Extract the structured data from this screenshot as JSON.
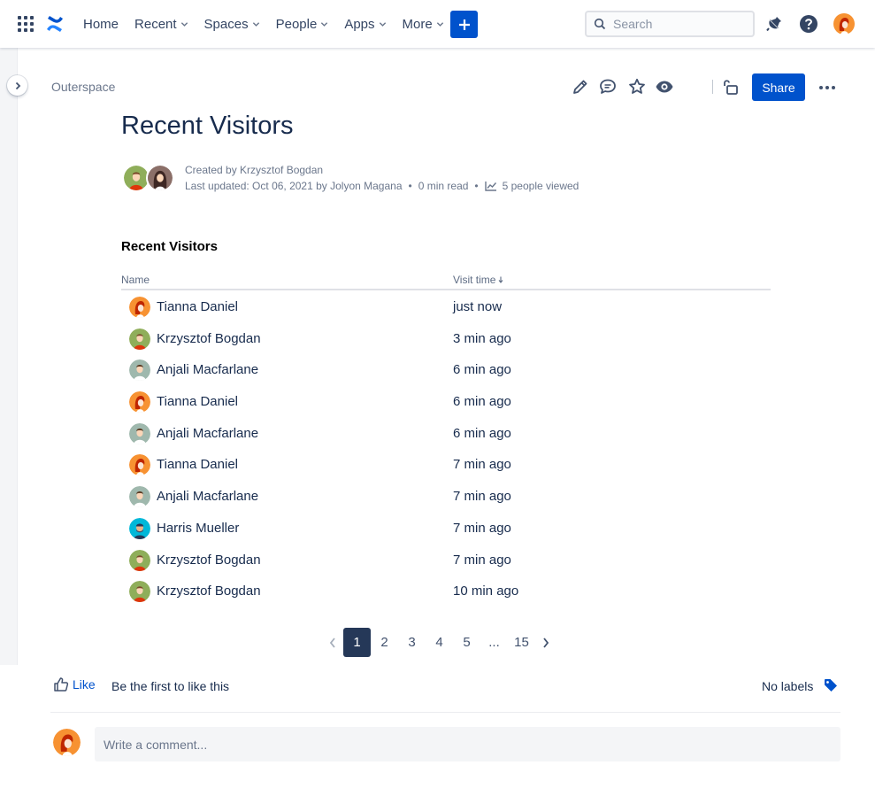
{
  "colors": {
    "brand": "#0052cc",
    "text": "#172b4d",
    "subtle": "#6b778c",
    "active_page": "#253858"
  },
  "topbar": {
    "nav": [
      {
        "label": "Home",
        "has_caret": false
      },
      {
        "label": "Recent",
        "has_caret": true
      },
      {
        "label": "Spaces",
        "has_caret": true
      },
      {
        "label": "People",
        "has_caret": true
      },
      {
        "label": "Apps",
        "has_caret": true
      },
      {
        "label": "More",
        "has_caret": true
      }
    ],
    "create_icon": "plus-icon",
    "search_placeholder": "Search",
    "icons": [
      "notification-icon",
      "help-icon",
      "user-avatar"
    ]
  },
  "breadcrumb": "Outerspace",
  "page_actions": {
    "icons": [
      "edit-icon",
      "comment-icon",
      "star-icon",
      "watch-icon",
      "restrictions-icon"
    ],
    "share_label": "Share"
  },
  "page": {
    "title": "Recent Visitors",
    "created_by": "Created by Krzysztof Bogdan",
    "last_updated": "Last updated: Oct 06, 2021 by Jolyon Magana",
    "read_time": "0 min read",
    "viewed": "5 people viewed"
  },
  "visitors": {
    "section_title": "Recent Visitors",
    "columns": {
      "name": "Name",
      "time": "Visit time"
    },
    "rows": [
      {
        "name": "Tianna Daniel",
        "time": "just now",
        "avatar": "tianna"
      },
      {
        "name": "Krzysztof Bogdan",
        "time": "3 min ago",
        "avatar": "krzysztof"
      },
      {
        "name": "Anjali Macfarlane",
        "time": "6 min ago",
        "avatar": "anjali"
      },
      {
        "name": "Tianna Daniel",
        "time": "6 min ago",
        "avatar": "tianna"
      },
      {
        "name": "Anjali Macfarlane",
        "time": "6 min ago",
        "avatar": "anjali"
      },
      {
        "name": "Tianna Daniel",
        "time": "7 min ago",
        "avatar": "tianna"
      },
      {
        "name": "Anjali Macfarlane",
        "time": "7 min ago",
        "avatar": "anjali"
      },
      {
        "name": "Harris Mueller",
        "time": "7 min ago",
        "avatar": "harris"
      },
      {
        "name": "Krzysztof Bogdan",
        "time": "7 min ago",
        "avatar": "krzysztof"
      },
      {
        "name": "Krzysztof Bogdan",
        "time": "10 min ago",
        "avatar": "krzysztof"
      }
    ]
  },
  "pagination": {
    "pages": [
      "1",
      "2",
      "3",
      "4",
      "5",
      "...",
      "15"
    ],
    "current": "1"
  },
  "footer": {
    "like_label": "Like",
    "like_text": "Be the first to like this",
    "labels_text": "No labels",
    "comment_placeholder": "Write a comment..."
  }
}
